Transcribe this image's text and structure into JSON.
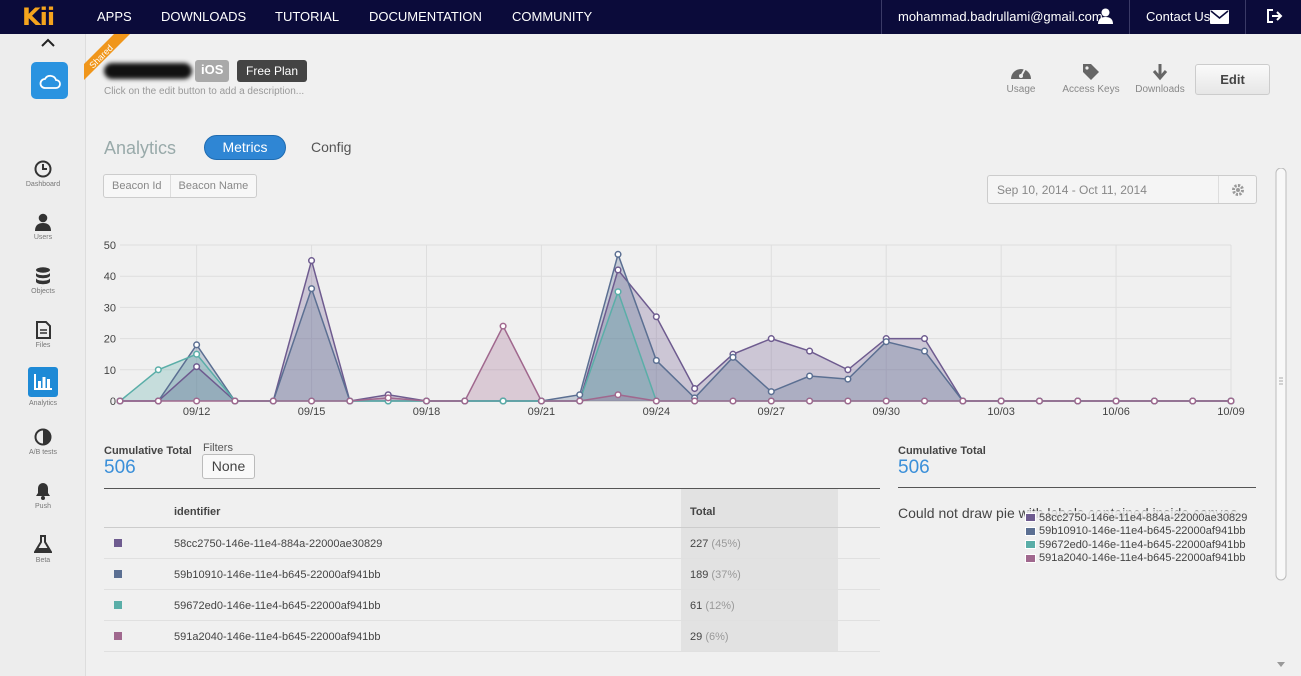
{
  "nav": {
    "logo": "Kii",
    "items": [
      "APPS",
      "DOWNLOADS",
      "TUTORIAL",
      "DOCUMENTATION",
      "COMMUNITY"
    ],
    "email": "mohammad.badrullami@gmail.com",
    "contact": "Contact Us"
  },
  "sidebar": {
    "items": [
      {
        "label": "Dashboard",
        "icon": "clock-icon"
      },
      {
        "label": "Users",
        "icon": "user-icon"
      },
      {
        "label": "Objects",
        "icon": "database-icon"
      },
      {
        "label": "Files",
        "icon": "file-icon"
      },
      {
        "label": "Analytics",
        "icon": "bar-chart-icon"
      },
      {
        "label": "A/B tests",
        "icon": "half-circle-icon"
      },
      {
        "label": "Push",
        "icon": "bell-icon"
      },
      {
        "label": "Beta",
        "icon": "flask-icon"
      }
    ]
  },
  "app": {
    "ribbon": "Shared",
    "platform": "iOS",
    "plan": "Free Plan",
    "description": "Click on the edit button to add a description..."
  },
  "header_tools": {
    "usage": "Usage",
    "access_keys": "Access Keys",
    "downloads": "Downloads",
    "edit": "Edit"
  },
  "tabs": {
    "analytics": "Analytics",
    "metrics": "Metrics",
    "config": "Config"
  },
  "segment": {
    "beacon_id": "Beacon Id",
    "beacon_name": "Beacon Name"
  },
  "date_range": "Sep 10, 2014 - Oct 11, 2014",
  "chart_data": {
    "type": "area",
    "x": [
      "09/10",
      "09/11",
      "09/12",
      "09/13",
      "09/14",
      "09/15",
      "09/16",
      "09/17",
      "09/18",
      "09/19",
      "09/20",
      "09/21",
      "09/22",
      "09/23",
      "09/24",
      "09/25",
      "09/26",
      "09/27",
      "09/28",
      "09/29",
      "09/30",
      "10/01",
      "10/02",
      "10/03",
      "10/04",
      "10/05",
      "10/06",
      "10/07",
      "10/08",
      "10/09"
    ],
    "xticks": [
      "09/12",
      "09/15",
      "09/18",
      "09/21",
      "09/24",
      "09/27",
      "09/30",
      "10/03",
      "10/06",
      "10/09"
    ],
    "ylim": [
      0,
      50
    ],
    "yticks": [
      0,
      10,
      20,
      30,
      40,
      50
    ],
    "grid": true,
    "series": [
      {
        "color": "#6e5b8f",
        "values": [
          0,
          0,
          11,
          0,
          0,
          45,
          0,
          2,
          0,
          0,
          0,
          0,
          0,
          42,
          27,
          4,
          15,
          20,
          16,
          10,
          20,
          20,
          0,
          0,
          0,
          0,
          0,
          0,
          0,
          0
        ]
      },
      {
        "color": "#5b6f92",
        "values": [
          0,
          0,
          18,
          0,
          0,
          36,
          0,
          0,
          0,
          0,
          0,
          0,
          2,
          47,
          13,
          1,
          14,
          3,
          8,
          7,
          19,
          16,
          0,
          0,
          0,
          0,
          0,
          0,
          0,
          0
        ]
      },
      {
        "color": "#5aaea8",
        "values": [
          0,
          10,
          15,
          0,
          0,
          0,
          0,
          0,
          0,
          0,
          0,
          0,
          0,
          35,
          0,
          0,
          0,
          0,
          0,
          0,
          0,
          0,
          0,
          0,
          0,
          0,
          0,
          0,
          0,
          0
        ]
      },
      {
        "color": "#a0688e",
        "values": [
          0,
          0,
          0,
          0,
          0,
          0,
          0,
          1,
          0,
          0,
          24,
          0,
          0,
          2,
          0,
          0,
          0,
          0,
          0,
          0,
          0,
          0,
          0,
          0,
          0,
          0,
          0,
          0,
          0,
          0
        ]
      }
    ]
  },
  "summary": {
    "cumulative_label": "Cumulative Total",
    "cumulative_value": "506",
    "filters_label": "Filters",
    "filters_value": "None",
    "pie_message": "Could not draw pie with labels contained inside canvas"
  },
  "table": {
    "headers": {
      "identifier": "identifier",
      "total": "Total"
    },
    "rows": [
      {
        "color": "#6e5b8f",
        "identifier": "58cc2750-146e-11e4-884a-22000ae30829",
        "total": "227",
        "pct": "(45%)"
      },
      {
        "color": "#5b6f92",
        "identifier": "59b10910-146e-11e4-b645-22000af941bb",
        "total": "189",
        "pct": "(37%)"
      },
      {
        "color": "#5aaea8",
        "identifier": "59672ed0-146e-11e4-b645-22000af941bb",
        "total": "61",
        "pct": "(12%)"
      },
      {
        "color": "#a0688e",
        "identifier": "591a2040-146e-11e4-b645-22000af941bb",
        "total": "29",
        "pct": "(6%)"
      }
    ]
  }
}
